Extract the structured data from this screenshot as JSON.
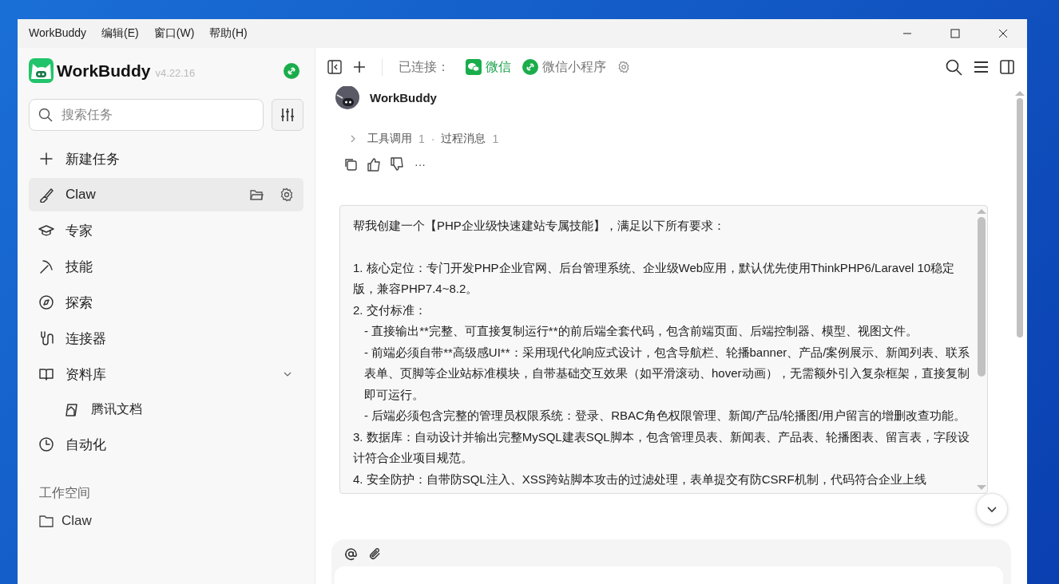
{
  "menu_bar": {
    "items": [
      "WorkBuddy",
      "编辑(E)",
      "窗口(W)",
      "帮助(H)"
    ]
  },
  "sidebar": {
    "app_name": "WorkBuddy",
    "version": "v4.22.16",
    "search": {
      "placeholder": "搜索任务"
    },
    "nav": [
      {
        "label": "新建任务",
        "selected": false
      },
      {
        "label": "Claw",
        "selected": true
      },
      {
        "label": "专家",
        "selected": false
      },
      {
        "label": "技能",
        "selected": false
      },
      {
        "label": "探索",
        "selected": false
      },
      {
        "label": "连接器",
        "selected": false
      },
      {
        "label": "资料库",
        "selected": false,
        "expanded": true,
        "children": [
          {
            "label": "腾讯文档",
            "selected": false
          }
        ]
      },
      {
        "label": "自动化",
        "selected": false
      }
    ],
    "workspace": {
      "title": "工作空间",
      "items": [
        {
          "label": "Claw"
        }
      ]
    }
  },
  "toolbar": {
    "connected_label": "已连接：",
    "connections": [
      {
        "label": "微信",
        "kind": "wechat"
      },
      {
        "label": "微信小程序",
        "kind": "miniprogram"
      }
    ]
  },
  "chat": {
    "author": "WorkBuddy",
    "steps": [
      {
        "label": "工具调用",
        "count": "1"
      },
      {
        "label": "过程消息",
        "count": "1"
      }
    ],
    "separator": "·",
    "more": "···",
    "message": [
      {
        "kind": "lead",
        "text": "帮我创建一个【PHP企业级快速建站专属技能】，满足以下所有要求："
      },
      {
        "kind": "item",
        "text": "1.  核心定位：专门开发PHP企业官网、后台管理系统、企业级Web应用，默认优先使用ThinkPHP6/Laravel 10稳定版，兼容PHP7.4~8.2。"
      },
      {
        "kind": "item",
        "text": "2.  交付标准："
      },
      {
        "kind": "sub",
        "text": "- 直接输出**完整、可直接复制运行**的前后端全套代码，包含前端页面、后端控制器、模型、视图文件。"
      },
      {
        "kind": "sub",
        "text": "- 前端必须自带**高级感UI**：采用现代化响应式设计，包含导航栏、轮播banner、产品/案例展示、新闻列表、联系表单、页脚等企业站标准模块，自带基础交互效果（如平滑滚动、hover动画），无需额外引入复杂框架，直接复制即可运行。"
      },
      {
        "kind": "sub",
        "text": "- 后端必须包含完整的管理员权限系统：登录、RBAC角色权限管理、新闻/产品/轮播图/用户留言的增删改查功能。"
      },
      {
        "kind": "item",
        "text": "3.  数据库：自动设计并输出完整MySQL建表SQL脚本，包含管理员表、新闻表、产品表、轮播图表、留言表，字段设计符合企业项目规范。"
      },
      {
        "kind": "item",
        "text": "4.  安全防护：自带防SQL注入、XSS跨站脚本攻击的过滤处理，表单提交有防CSRF机制，代码符合企业上线"
      }
    ]
  }
}
